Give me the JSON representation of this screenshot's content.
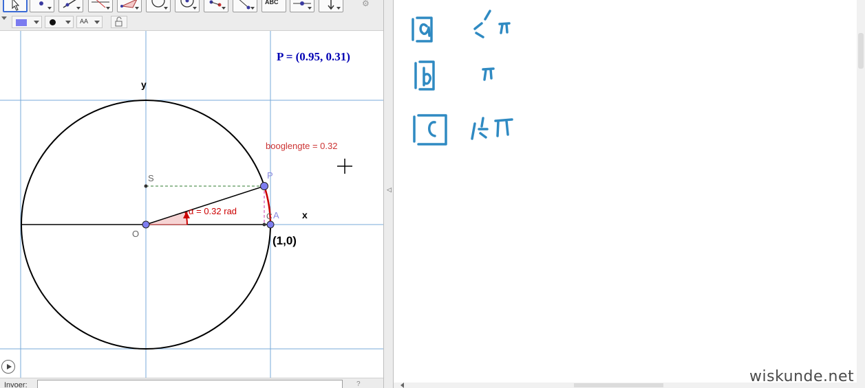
{
  "graphics": {
    "coords_label": "P = (0.95, 0.31)",
    "arc_length_label": "booglengte = 0.32",
    "angle_label": "α = 0.32 rad",
    "axis_x": "x",
    "axis_y": "y",
    "point_S": "S",
    "point_P": "P",
    "point_A": "A",
    "point_C": "C",
    "point_O": "O",
    "one_zero": "(1,0)",
    "colors": {
      "arc": "#cc0000",
      "circle": "#000000",
      "point": "#7e7ef0",
      "coords": "#0000b4",
      "grid": "#77aad8"
    }
  },
  "stylebar": {
    "color_swatch": "#7b7bf0",
    "font_size_label": "AA"
  },
  "toolbar": {
    "text_tool_label": "ABC"
  },
  "inputbar": {
    "label": "Invoer:",
    "value": ""
  },
  "watermark": "wiskunde.net",
  "handwriting": {
    "row_a": {
      "label": "a",
      "answer": "½π"
    },
    "row_b": {
      "label": "b",
      "answer": "π"
    },
    "row_c": {
      "label": "c",
      "answer": "1½π"
    }
  }
}
